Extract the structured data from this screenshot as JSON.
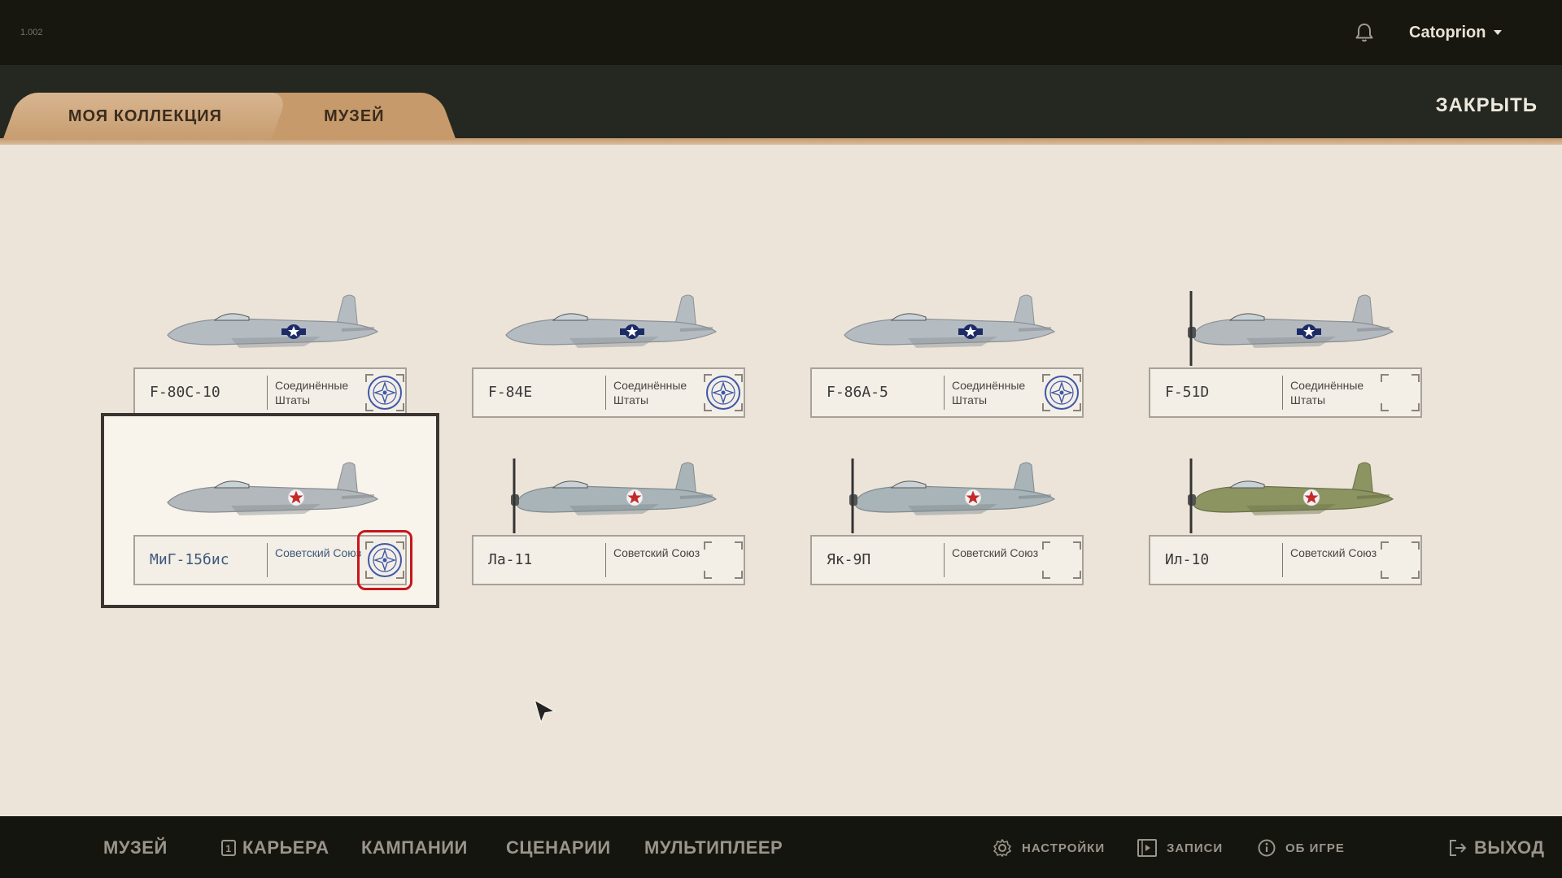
{
  "version": "1.002",
  "user": {
    "name": "Catoprion"
  },
  "tabs": {
    "collection": "МОЯ КОЛЛЕКЦИЯ",
    "museum": "МУЗЕЙ"
  },
  "close_label": "ЗАКРЫТЬ",
  "aircraft": [
    {
      "name": "F-80C-10",
      "country": "Соединённые Штаты",
      "stamped": true,
      "selected": false,
      "livery": "silver-us"
    },
    {
      "name": "F-84E",
      "country": "Соединённые Штаты",
      "stamped": true,
      "selected": false,
      "livery": "silver-us"
    },
    {
      "name": "F-86A-5",
      "country": "Соединённые Штаты",
      "stamped": true,
      "selected": false,
      "livery": "silver-us"
    },
    {
      "name": "F-51D",
      "country": "Соединённые Штаты",
      "stamped": false,
      "selected": false,
      "livery": "silver-us-prop"
    },
    {
      "name": "МиГ-15бис",
      "country": "Советский Союз",
      "stamped": true,
      "selected": true,
      "livery": "silver-soviet"
    },
    {
      "name": "Ла-11",
      "country": "Советский Союз",
      "stamped": false,
      "selected": false,
      "livery": "grey-soviet-prop"
    },
    {
      "name": "Як-9П",
      "country": "Советский Союз",
      "stamped": false,
      "selected": false,
      "livery": "grey-soviet-prop"
    },
    {
      "name": "Ил-10",
      "country": "Советский Союз",
      "stamped": false,
      "selected": false,
      "livery": "green-soviet-prop"
    }
  ],
  "nav": {
    "museum": "МУЗЕЙ",
    "career": "КАРЬЕРА",
    "career_badge": "1",
    "campaigns": "КАМПАНИИ",
    "scenarios": "СЦЕНАРИИ",
    "multiplayer": "МУЛЬТИПЛЕЕР",
    "settings": "НАСТРОЙКИ",
    "records": "ЗАПИСИ",
    "about": "ОБ ИГРЕ",
    "exit": "ВЫХОД"
  },
  "colors": {
    "background": "#ece4d9",
    "bar_dark": "#17160f",
    "tab_accent": "#c69a6a",
    "stamp_blue": "#3e58a8",
    "highlight_red": "#c8161c",
    "star_red": "#c42a2a"
  },
  "icons": [
    "bell-icon",
    "caret-down-icon",
    "stamp-icon",
    "gear-icon",
    "film-icon",
    "info-icon",
    "exit-icon",
    "cursor-icon"
  ]
}
